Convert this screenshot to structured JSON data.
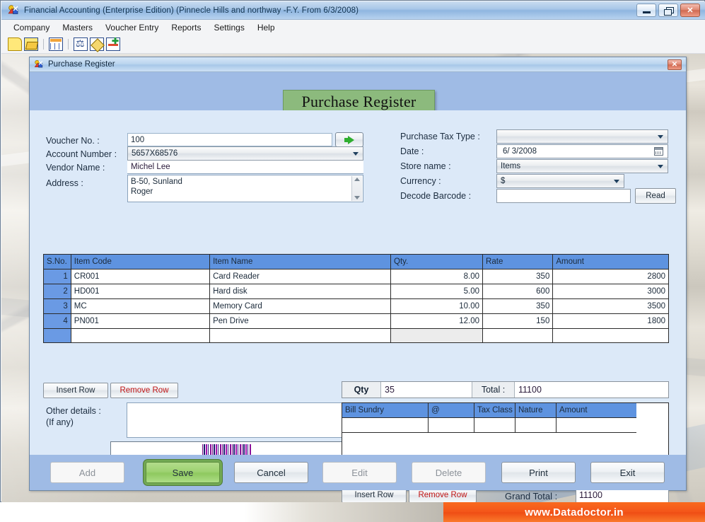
{
  "window": {
    "title": "Financial Accounting (Enterprise Edition) (Pinnecle Hills and northway -F.Y. From 6/3/2008)",
    "icon": "app-icon",
    "minimize": "_",
    "maximize": "",
    "close": "✕"
  },
  "menu": {
    "items": [
      {
        "label": "Company"
      },
      {
        "label": "Masters"
      },
      {
        "label": "Voucher Entry"
      },
      {
        "label": "Reports"
      },
      {
        "label": "Settings"
      },
      {
        "label": "Help"
      }
    ]
  },
  "toolbar": {
    "icons": [
      "new-document-icon",
      "open-folder-icon",
      "ledger-grid-icon",
      "trial-balance-icon",
      "journal-book-icon",
      "add-entry-icon"
    ]
  },
  "dialog": {
    "title": "Purchase Register",
    "icon": "dialog-app-icon",
    "close": "✕",
    "banner_title": "Purchase Register"
  },
  "form": {
    "left": {
      "voucher_no_label": "Voucher No. :",
      "voucher_no_value": "100",
      "go_button_icon": "green-arrow-icon",
      "account_number_label": "Account Number :",
      "account_number_value": "5657X68576",
      "vendor_name_label": "Vendor Name :",
      "vendor_name_value": "Michel Lee",
      "address_label": "Address :",
      "address_value": "B-50, Sunland\nRoger"
    },
    "right": {
      "purchase_tax_type_label": "Purchase Tax Type :",
      "purchase_tax_type_value": "",
      "date_label": "Date :",
      "date_value": "6/  3/2008",
      "store_name_label": "Store name :",
      "store_name_value": "Items",
      "currency_label": "Currency :",
      "currency_value": "$",
      "decode_barcode_label": "Decode Barcode :",
      "decode_barcode_value": "",
      "read_button": "Read"
    }
  },
  "items_grid": {
    "columns": [
      "S.No.",
      "Item Code",
      "Item Name",
      "Qty.",
      "Rate",
      "Amount"
    ],
    "rows": [
      {
        "sno": "1",
        "code": "CR001",
        "name": "Card Reader",
        "qty": "8.00",
        "rate": "350",
        "amount": "2800"
      },
      {
        "sno": "2",
        "code": "HD001",
        "name": "Hard disk",
        "qty": "5.00",
        "rate": "600",
        "amount": "3000"
      },
      {
        "sno": "3",
        "code": "MC",
        "name": "Memory Card",
        "qty": "10.00",
        "rate": "350",
        "amount": "3500"
      },
      {
        "sno": "4",
        "code": "PN001",
        "name": "Pen Drive",
        "qty": "12.00",
        "rate": "150",
        "amount": "1800"
      },
      {
        "sno": "",
        "code": "",
        "name": "",
        "qty": "",
        "rate": "",
        "amount": ""
      }
    ]
  },
  "grid_actions": {
    "insert_row": "Insert Row",
    "remove_row": "Remove Row"
  },
  "totals": {
    "qty_label": "Qty",
    "qty_value": "35",
    "total_label": "Total :",
    "total_value": "11100",
    "grand_total_label": "Grand Total :",
    "grand_total_value": "11100"
  },
  "other_details": {
    "label_line1": "Other details :",
    "label_line2": "(If any)",
    "value": "",
    "barcode_icon": "barcode-image"
  },
  "bill_sundry_grid": {
    "columns": [
      "Bill Sundry",
      "@",
      "Tax Class",
      "Nature",
      "Amount"
    ],
    "rows": [
      {
        "sundry": "",
        "at": "",
        "tax_class": "",
        "nature": "",
        "amount": ""
      }
    ],
    "insert_row": "Insert Row",
    "remove_row": "Remove Row"
  },
  "footer_buttons": [
    {
      "label": "Add",
      "state": "disabled"
    },
    {
      "label": "Save",
      "state": "focused"
    },
    {
      "label": "Cancel",
      "state": "normal"
    },
    {
      "label": "Edit",
      "state": "disabled"
    },
    {
      "label": "Delete",
      "state": "disabled"
    },
    {
      "label": "Print",
      "state": "normal"
    },
    {
      "label": "Exit",
      "state": "normal"
    }
  ],
  "branding": {
    "website": "www.Datadoctor.in"
  },
  "colors": {
    "titlebar_blue": "#a9c7e8",
    "dialog_band": "#9fbbe5",
    "dialog_body": "#dce9f8",
    "grid_header": "#5e93e0",
    "banner_green": "#8cba7d",
    "save_green": "#9ed272",
    "orange": "#f4561a",
    "red_text": "#c01414"
  }
}
